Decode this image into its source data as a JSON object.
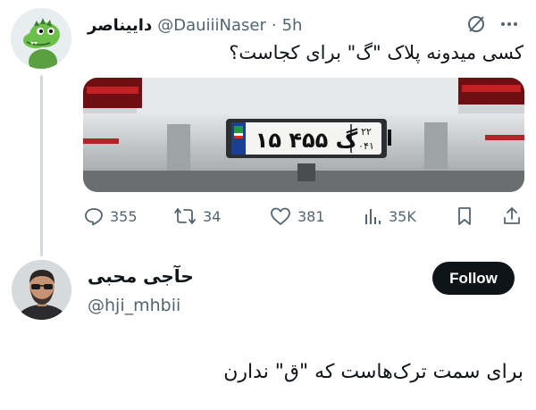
{
  "tweet1": {
    "author_name": "داییناصر",
    "handle": "@DauiiiNaser",
    "separator": "·",
    "time": "5h",
    "text": "کسی میدونه پلاک \"گ\" برای کجاست؟",
    "icons": {
      "grok": "grok-slash-icon",
      "more": "more-icon"
    },
    "media": {
      "plate_main": "۱۵ گ ۴۵۵",
      "plate_region_top": "۲۲",
      "plate_region_bottom": "۰۴۱"
    },
    "stats": {
      "replies": "355",
      "reposts": "34",
      "likes": "381",
      "views": "35K"
    }
  },
  "tweet2": {
    "author_name": "حآجی محبی",
    "handle": "@hji_mhbii",
    "follow_label": "Follow",
    "text": "برای سمت ترک‌هاست که \"ق\" ندارن"
  },
  "colors": {
    "text_primary": "#0f1419",
    "text_secondary": "#536471",
    "thread_line": "#cfd9de",
    "follow_bg": "#0f1419"
  }
}
